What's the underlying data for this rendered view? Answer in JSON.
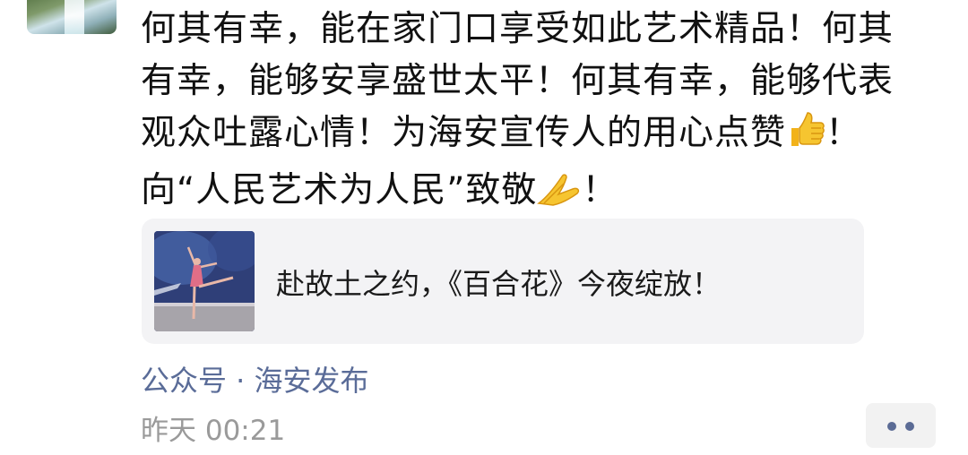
{
  "post": {
    "lines": [
      "何其有幸，能在家门口享受如此艺术精品！何其",
      "有幸，能够安享盛世太平！何其有幸，能够代表",
      "观众吐露心情！为海安宣传人的用心点赞",
      "向“人民艺术为人民”致敬"
    ],
    "line3_tail": "！",
    "line4_tail": "！",
    "emoji_1": "thumbs-up-icon",
    "emoji_2": "folded-hands-icon"
  },
  "link_card": {
    "title": "赴故土之约，《百合花》今夜绽放！",
    "thumbnail": "ballet-dancer-image"
  },
  "source": {
    "text": "公众号 · 海安发布"
  },
  "timestamp": {
    "text": "昨天 00:21"
  },
  "colors": {
    "link_blue": "#5a6c98",
    "time_gray": "#9a9a9a",
    "card_bg": "#f3f3f5"
  }
}
